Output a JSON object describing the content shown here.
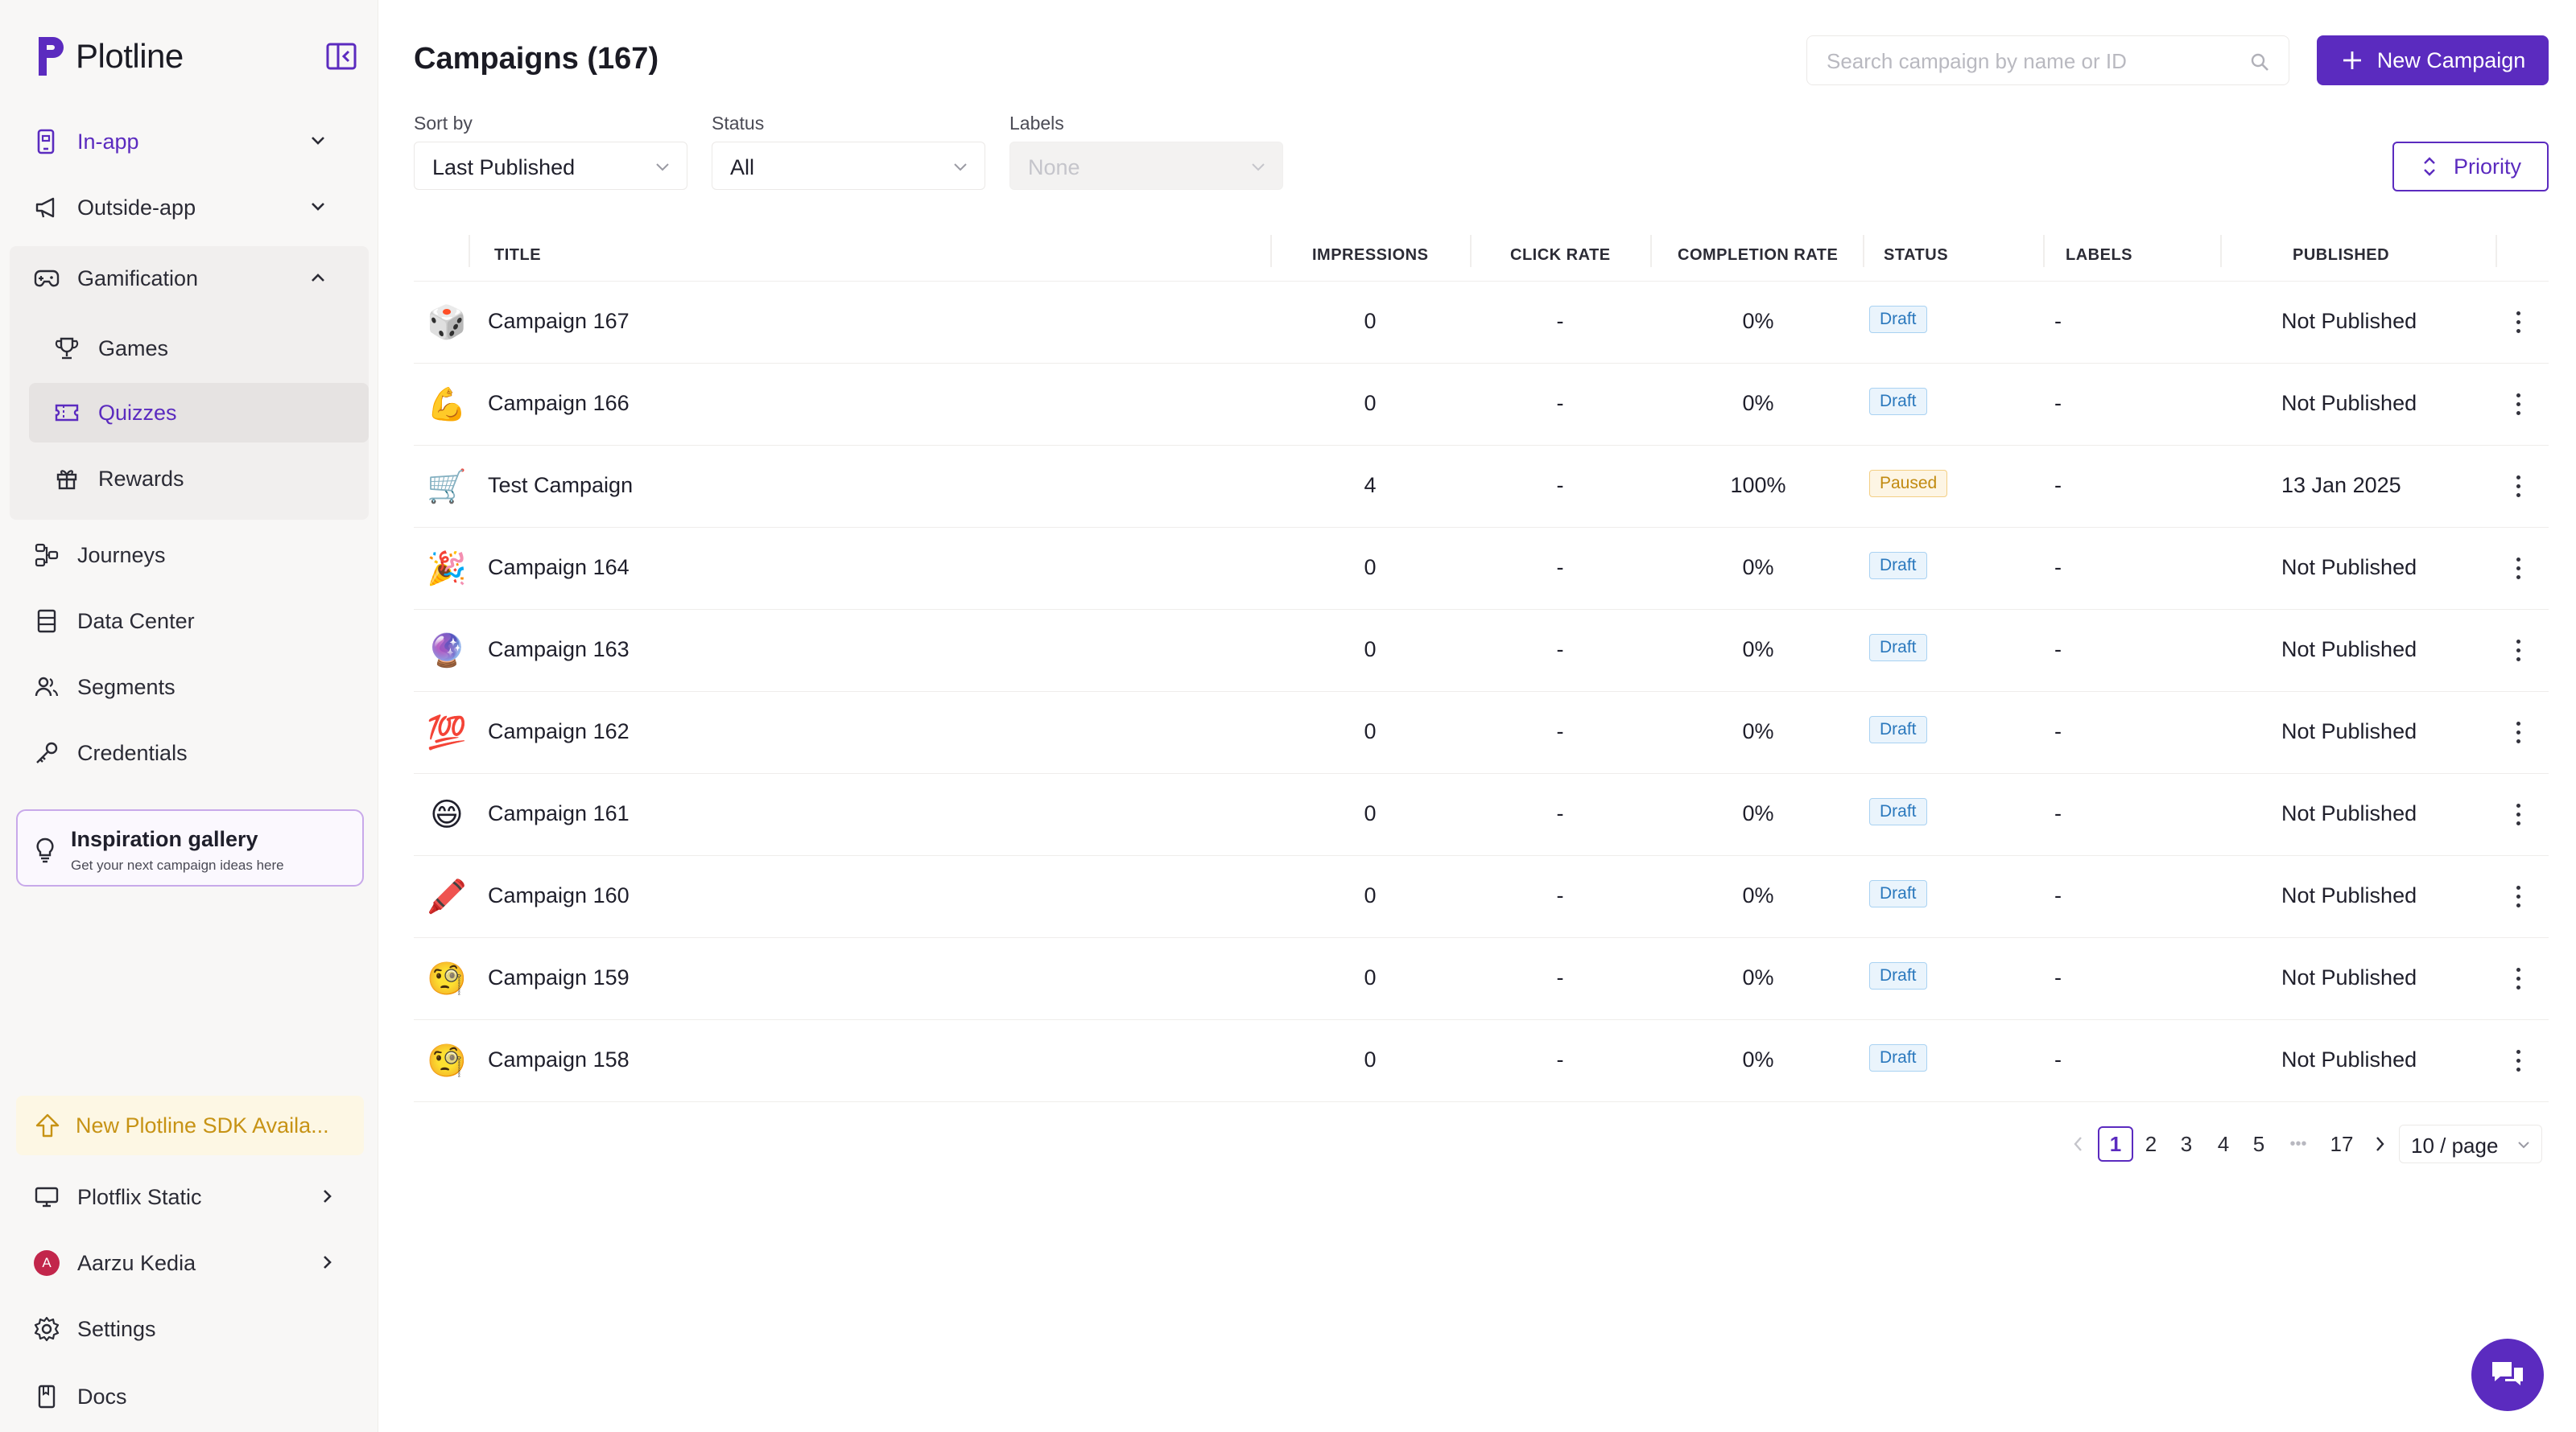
{
  "app": {
    "name": "Plotline"
  },
  "sidebar": {
    "nav": [
      {
        "key": "in-app",
        "label": "In-app"
      },
      {
        "key": "outside-app",
        "label": "Outside-app"
      },
      {
        "key": "gamification",
        "label": "Gamification"
      }
    ],
    "gamification_items": [
      {
        "label": "Games"
      },
      {
        "label": "Quizzes"
      },
      {
        "label": "Rewards"
      }
    ],
    "more_nav": [
      {
        "label": "Journeys"
      },
      {
        "label": "Data Center"
      },
      {
        "label": "Segments"
      },
      {
        "label": "Credentials"
      }
    ],
    "inspiration": {
      "title": "Inspiration gallery",
      "subtitle": "Get your next campaign ideas here"
    },
    "sdk_banner": "New Plotline SDK Availa...",
    "workspace": "Plotflix Static",
    "user": {
      "name": "Aarzu Kedia",
      "initial": "A"
    },
    "settings": "Settings",
    "docs": "Docs"
  },
  "header": {
    "title": "Campaigns (167)",
    "search_placeholder": "Search campaign by name or ID",
    "new_button": "New Campaign"
  },
  "filters": {
    "sort": {
      "label": "Sort by",
      "value": "Last Published"
    },
    "status": {
      "label": "Status",
      "value": "All"
    },
    "labels": {
      "label": "Labels",
      "value": "None"
    },
    "priority_button": "Priority"
  },
  "table": {
    "columns": [
      "TITLE",
      "IMPRESSIONS",
      "CLICK RATE",
      "COMPLETION RATE",
      "STATUS",
      "LABELS",
      "PUBLISHED"
    ],
    "rows": [
      {
        "emoji": "🎲",
        "title": "Campaign 167",
        "impressions": "0",
        "click_rate": "-",
        "completion_rate": "0%",
        "status": "Draft",
        "labels": "-",
        "published": "Not Published"
      },
      {
        "emoji": "💪",
        "title": "Campaign 166",
        "impressions": "0",
        "click_rate": "-",
        "completion_rate": "0%",
        "status": "Draft",
        "labels": "-",
        "published": "Not Published"
      },
      {
        "emoji": "🛒",
        "title": "Test Campaign",
        "impressions": "4",
        "click_rate": "-",
        "completion_rate": "100%",
        "status": "Paused",
        "labels": "-",
        "published": "13 Jan 2025"
      },
      {
        "emoji": "🎉",
        "title": "Campaign 164",
        "impressions": "0",
        "click_rate": "-",
        "completion_rate": "0%",
        "status": "Draft",
        "labels": "-",
        "published": "Not Published"
      },
      {
        "emoji": "🔮",
        "title": "Campaign 163",
        "impressions": "0",
        "click_rate": "-",
        "completion_rate": "0%",
        "status": "Draft",
        "labels": "-",
        "published": "Not Published"
      },
      {
        "emoji": "💯",
        "title": "Campaign 162",
        "impressions": "0",
        "click_rate": "-",
        "completion_rate": "0%",
        "status": "Draft",
        "labels": "-",
        "published": "Not Published"
      },
      {
        "emoji": "😄",
        "title": "Campaign 161",
        "impressions": "0",
        "click_rate": "-",
        "completion_rate": "0%",
        "status": "Draft",
        "labels": "-",
        "published": "Not Published"
      },
      {
        "emoji": "🖍️",
        "title": "Campaign 160",
        "impressions": "0",
        "click_rate": "-",
        "completion_rate": "0%",
        "status": "Draft",
        "labels": "-",
        "published": "Not Published"
      },
      {
        "emoji": "🧐",
        "title": "Campaign 159",
        "impressions": "0",
        "click_rate": "-",
        "completion_rate": "0%",
        "status": "Draft",
        "labels": "-",
        "published": "Not Published"
      },
      {
        "emoji": "🧐",
        "title": "Campaign 158",
        "impressions": "0",
        "click_rate": "-",
        "completion_rate": "0%",
        "status": "Draft",
        "labels": "-",
        "published": "Not Published"
      }
    ]
  },
  "pagination": {
    "pages": [
      "1",
      "2",
      "3",
      "4",
      "5"
    ],
    "ellipsis": "•••",
    "last_page": "17",
    "current": "1",
    "page_size": "10 / page"
  },
  "colors": {
    "accent": "#5b2bbf",
    "draft": "#2a78bd",
    "paused": "#c18a10",
    "sdk": "#c79315"
  }
}
